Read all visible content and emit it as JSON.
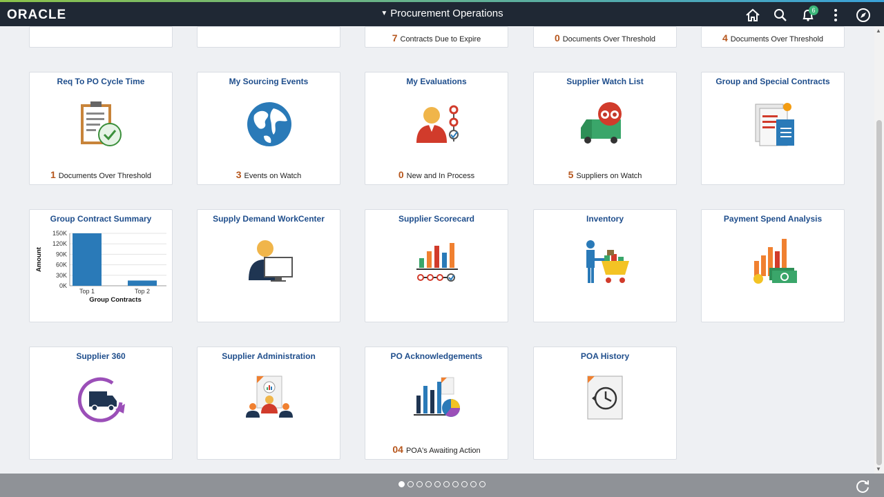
{
  "header": {
    "logo": "ORACLE",
    "title": "Procurement Operations",
    "notification_count": "6",
    "icons": [
      "home-icon",
      "search-icon",
      "bell-icon",
      "more-icon",
      "navbar-icon"
    ]
  },
  "top_row": [
    {
      "count": "",
      "label": ""
    },
    {
      "count": "",
      "label": ""
    },
    {
      "count": "7",
      "label": "Contracts Due to Expire"
    },
    {
      "count": "0",
      "label": "Documents Over Threshold"
    },
    {
      "count": "4",
      "label": "Documents Over Threshold"
    }
  ],
  "tiles": [
    {
      "title": "Req To PO Cycle Time",
      "count": "1",
      "label": "Documents Over Threshold",
      "icon": "clipboard-check-icon"
    },
    {
      "title": "My Sourcing Events",
      "count": "3",
      "label": "Events on Watch",
      "icon": "globe-icon"
    },
    {
      "title": "My Evaluations",
      "count": "0",
      "label": "New and In Process",
      "icon": "evaluator-icon"
    },
    {
      "title": "Supplier Watch List",
      "count": "5",
      "label": "Suppliers on Watch",
      "icon": "truck-binoculars-icon"
    },
    {
      "title": "Group and Special Contracts",
      "count": "",
      "label": "",
      "icon": "contracts-docs-icon"
    },
    {
      "title": "Group Contract Summary",
      "count": "",
      "label": "",
      "icon": "chart"
    },
    {
      "title": "Supply Demand WorkCenter",
      "count": "",
      "label": "",
      "icon": "person-monitor-icon"
    },
    {
      "title": "Supplier Scorecard",
      "count": "",
      "label": "",
      "icon": "scorecard-chart-icon"
    },
    {
      "title": "Inventory",
      "count": "",
      "label": "",
      "icon": "inventory-cart-icon"
    },
    {
      "title": "Payment Spend Analysis",
      "count": "",
      "label": "",
      "icon": "payment-spend-icon"
    },
    {
      "title": "Supplier 360",
      "count": "",
      "label": "",
      "icon": "truck-cycle-icon"
    },
    {
      "title": "Supplier Administration",
      "count": "",
      "label": "",
      "icon": "supplier-admin-icon"
    },
    {
      "title": "PO Acknowledgements",
      "count": "04",
      "label": "POA's Awaiting Action",
      "icon": "bar-pie-icon"
    },
    {
      "title": "POA History",
      "count": "",
      "label": "",
      "icon": "history-doc-icon"
    }
  ],
  "chart_data": {
    "type": "bar",
    "title": "Group Contract Summary",
    "categories": [
      "Top 1",
      "Top 2"
    ],
    "values": [
      150000,
      15000
    ],
    "xlabel": "Group Contracts",
    "ylabel": "Amount",
    "ylim": [
      0,
      150000
    ],
    "ytick_labels": [
      "150K",
      "120K",
      "90K",
      "60K",
      "30K",
      "0K"
    ],
    "yticks": [
      150000,
      120000,
      90000,
      60000,
      30000,
      0
    ],
    "bar_color": "#2a7ab8",
    "grid": true
  },
  "pager": {
    "total": 10,
    "active": 0
  },
  "colors": {
    "header_bg": "#1f2834",
    "tile_title": "#1f4e8c",
    "count": "#b6561c",
    "footer_bg": "#8f9297"
  }
}
